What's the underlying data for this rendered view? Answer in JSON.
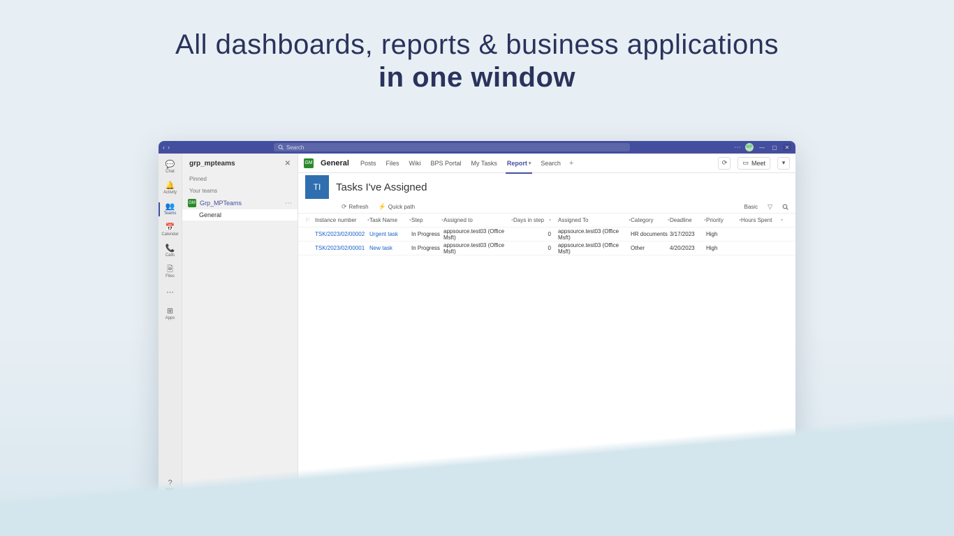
{
  "hero": {
    "line1": "All dashboards, reports & business applications",
    "line2": "in one window"
  },
  "titlebar": {
    "search_placeholder": "Search",
    "avatar": "MP"
  },
  "rail": {
    "items": [
      {
        "id": "chat",
        "label": "Chat"
      },
      {
        "id": "activity",
        "label": "Activity"
      },
      {
        "id": "teams",
        "label": "Teams"
      },
      {
        "id": "calendar",
        "label": "Calendar"
      },
      {
        "id": "calls",
        "label": "Calls"
      },
      {
        "id": "files",
        "label": "Files"
      },
      {
        "id": "more",
        "label": ""
      },
      {
        "id": "apps",
        "label": "Apps"
      }
    ],
    "help_label": "Help"
  },
  "panel": {
    "title": "grp_mpteams",
    "pinned_label": "Pinned",
    "your_teams_label": "Your teams",
    "team_name": "Grp_MPTeams",
    "team_initials": "GM",
    "channel": "General"
  },
  "tabs": {
    "badge": "GM",
    "channel": "General",
    "items": [
      "Posts",
      "Files",
      "Wiki",
      "BPS Portal",
      "My Tasks",
      "Report",
      "Search"
    ],
    "active_index": 5,
    "meet_label": "Meet"
  },
  "report": {
    "badge": "TI",
    "title": "Tasks I've Assigned",
    "refresh": "Refresh",
    "quickpath": "Quick path",
    "basic": "Basic"
  },
  "columns": [
    "Instance number",
    "Task Name",
    "Step",
    "Assigned to",
    "Days in step",
    "Assigned To",
    "Category",
    "Deadline",
    "Priority",
    "Hours Spent"
  ],
  "rows": [
    {
      "instance": "TSK/2023/02/00002",
      "name": "Urgent task",
      "step": "In Progress",
      "assigned_to": "appsource.test03 (Office Msft)",
      "days": "0",
      "assigned_to2": "appsource.test03 (Office Msft)",
      "category": "HR documents",
      "deadline": "3/17/2023",
      "priority": "High",
      "hours": ""
    },
    {
      "instance": "TSK/2023/02/00001",
      "name": "New task",
      "step": "In Progress",
      "assigned_to": "appsource.test03 (Office Msft)",
      "days": "0",
      "assigned_to2": "appsource.test03 (Office Msft)",
      "category": "Other",
      "deadline": "4/20/2023",
      "priority": "High",
      "hours": ""
    }
  ]
}
